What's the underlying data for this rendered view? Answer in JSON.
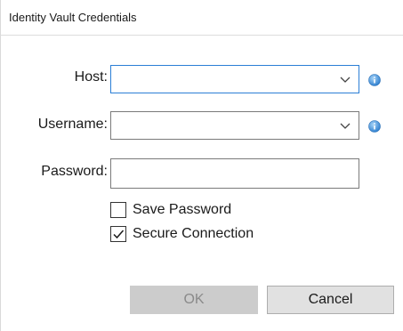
{
  "window": {
    "title": "Identity Vault Credentials"
  },
  "form": {
    "host": {
      "label": "Host:",
      "value": "",
      "info_icon": "info-icon"
    },
    "username": {
      "label": "Username:",
      "value": "",
      "info_icon": "info-icon"
    },
    "password": {
      "label": "Password:",
      "value": ""
    },
    "save_password": {
      "label": "Save Password",
      "checked": false
    },
    "secure_connection": {
      "label": "Secure Connection",
      "checked": true
    }
  },
  "buttons": {
    "ok_label": "OK",
    "ok_enabled": false,
    "cancel_label": "Cancel"
  },
  "colors": {
    "focus_border": "#2b7fd6",
    "info_icon": "#3a8fd8"
  }
}
